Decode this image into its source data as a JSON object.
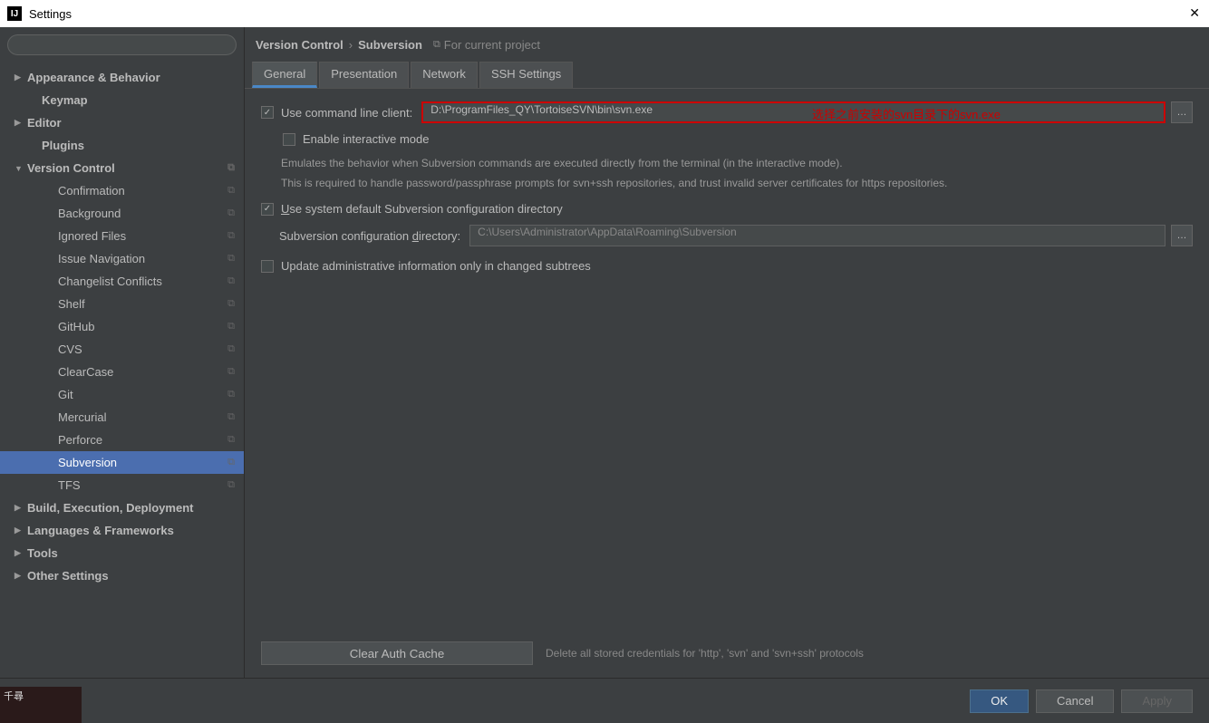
{
  "window": {
    "title": "Settings"
  },
  "search": {
    "placeholder": ""
  },
  "tree": {
    "items": [
      {
        "label": "Appearance & Behavior",
        "bold": true,
        "arrow": "▶",
        "level": 0
      },
      {
        "label": "Keymap",
        "bold": true,
        "arrow": "",
        "level": 1
      },
      {
        "label": "Editor",
        "bold": true,
        "arrow": "▶",
        "level": 0
      },
      {
        "label": "Plugins",
        "bold": true,
        "arrow": "",
        "level": 1
      },
      {
        "label": "Version Control",
        "bold": true,
        "arrow": "▼",
        "level": 0,
        "copy": true
      },
      {
        "label": "Confirmation",
        "level": 2,
        "copy": true
      },
      {
        "label": "Background",
        "level": 2,
        "copy": true
      },
      {
        "label": "Ignored Files",
        "level": 2,
        "copy": true
      },
      {
        "label": "Issue Navigation",
        "level": 2,
        "copy": true
      },
      {
        "label": "Changelist Conflicts",
        "level": 2,
        "copy": true
      },
      {
        "label": "Shelf",
        "level": 2,
        "copy": true
      },
      {
        "label": "GitHub",
        "level": 2,
        "copy": true
      },
      {
        "label": "CVS",
        "level": 2,
        "copy": true
      },
      {
        "label": "ClearCase",
        "level": 2,
        "copy": true
      },
      {
        "label": "Git",
        "level": 2,
        "copy": true
      },
      {
        "label": "Mercurial",
        "level": 2,
        "copy": true
      },
      {
        "label": "Perforce",
        "level": 2,
        "copy": true
      },
      {
        "label": "Subversion",
        "level": 2,
        "copy": true,
        "selected": true
      },
      {
        "label": "TFS",
        "level": 2,
        "copy": true
      },
      {
        "label": "Build, Execution, Deployment",
        "bold": true,
        "arrow": "▶",
        "level": 0
      },
      {
        "label": "Languages & Frameworks",
        "bold": true,
        "arrow": "▶",
        "level": 0
      },
      {
        "label": "Tools",
        "bold": true,
        "arrow": "▶",
        "level": 0
      },
      {
        "label": "Other Settings",
        "bold": true,
        "arrow": "▶",
        "level": 0
      }
    ]
  },
  "breadcrumb": {
    "crumb1": "Version Control",
    "crumb2": "Subversion",
    "hint": "For current project"
  },
  "tabs": [
    {
      "label": "General",
      "active": true
    },
    {
      "label": "Presentation"
    },
    {
      "label": "Network"
    },
    {
      "label": "SSH Settings"
    }
  ],
  "form": {
    "useCli": {
      "label": "Use command line client:",
      "checked": true
    },
    "cliPath": "D:\\ProgramFiles_QY\\TortoiseSVN\\bin\\svn.exe",
    "annotation": "选择之前安装的svn目录下的svn.exe",
    "interactive": {
      "label": "Enable interactive mode",
      "checked": false
    },
    "interactiveDesc1": "Emulates the behavior when Subversion commands are executed directly from the terminal (in the interactive mode).",
    "interactiveDesc2": "This is required to handle password/passphrase prompts for svn+ssh repositories, and trust invalid server certificates for https repositories.",
    "useDefault": {
      "labelPrefix": "U",
      "labelRest": "se system default Subversion configuration directory",
      "checked": true
    },
    "configDir": {
      "labelRest": "Subversion configuration ",
      "labelU": "d",
      "labelAfter": "irectory:",
      "value": "C:\\Users\\Administrator\\AppData\\Roaming\\Subversion"
    },
    "updateAdmin": {
      "label": "Update administrative information only in changed subtrees",
      "checked": false
    },
    "clearCache": {
      "label": "Clear Auth Cache",
      "desc": "Delete all stored credentials for 'http', 'svn' and 'svn+ssh' protocols"
    }
  },
  "footer": {
    "ok": "OK",
    "cancel": "Cancel",
    "apply": "Apply"
  },
  "corner": {
    "text": "千尋"
  }
}
